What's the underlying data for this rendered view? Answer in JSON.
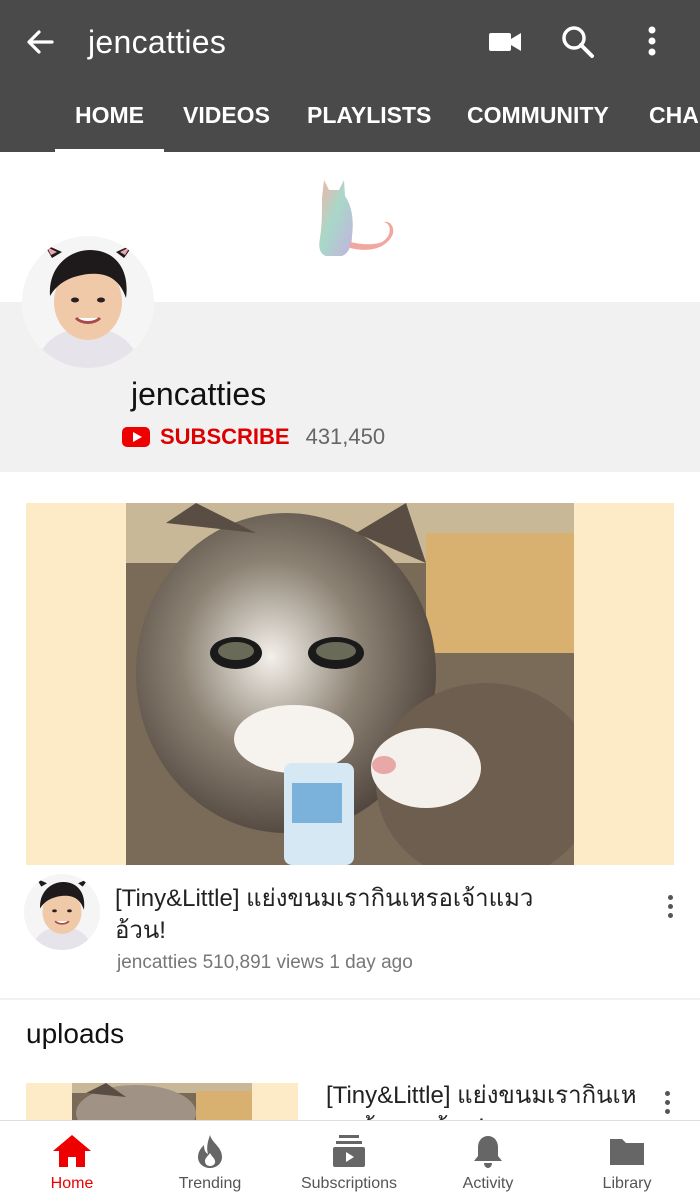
{
  "header": {
    "title": "jencatties",
    "icons": [
      "back-arrow-icon",
      "video-camera-icon",
      "search-icon",
      "more-vert-icon"
    ]
  },
  "tabs": [
    {
      "label": "HOME",
      "active": true
    },
    {
      "label": "VIDEOS"
    },
    {
      "label": "PLAYLISTS"
    },
    {
      "label": "COMMUNITY"
    },
    {
      "label": "CHANNELS"
    }
  ],
  "channel": {
    "name": "jencatties",
    "subscribe_label": "SUBSCRIBE",
    "subscriber_count": "431,450"
  },
  "featured": {
    "title": "[Tiny&Little] แย่งขนมเรากินเหรอเจ้าแมวอ้วน!",
    "channel": "jencatties",
    "views": "510,891 views",
    "age": "1 day ago"
  },
  "uploads": {
    "heading": "uploads",
    "first_title": "[Tiny&Little] แย่งขนมเรากินเหรอเจ้าแมวอ้วน!"
  },
  "bottom_nav": [
    {
      "label": "Home",
      "icon": "home-icon",
      "active": true
    },
    {
      "label": "Trending",
      "icon": "flame-icon"
    },
    {
      "label": "Subscriptions",
      "icon": "subscriptions-icon"
    },
    {
      "label": "Activity",
      "icon": "bell-icon"
    },
    {
      "label": "Library",
      "icon": "folder-icon"
    }
  ],
  "colors": {
    "appbar": "#4a4a4a",
    "accent_red": "#e00000",
    "thumb_bg": "#fdebc8"
  }
}
